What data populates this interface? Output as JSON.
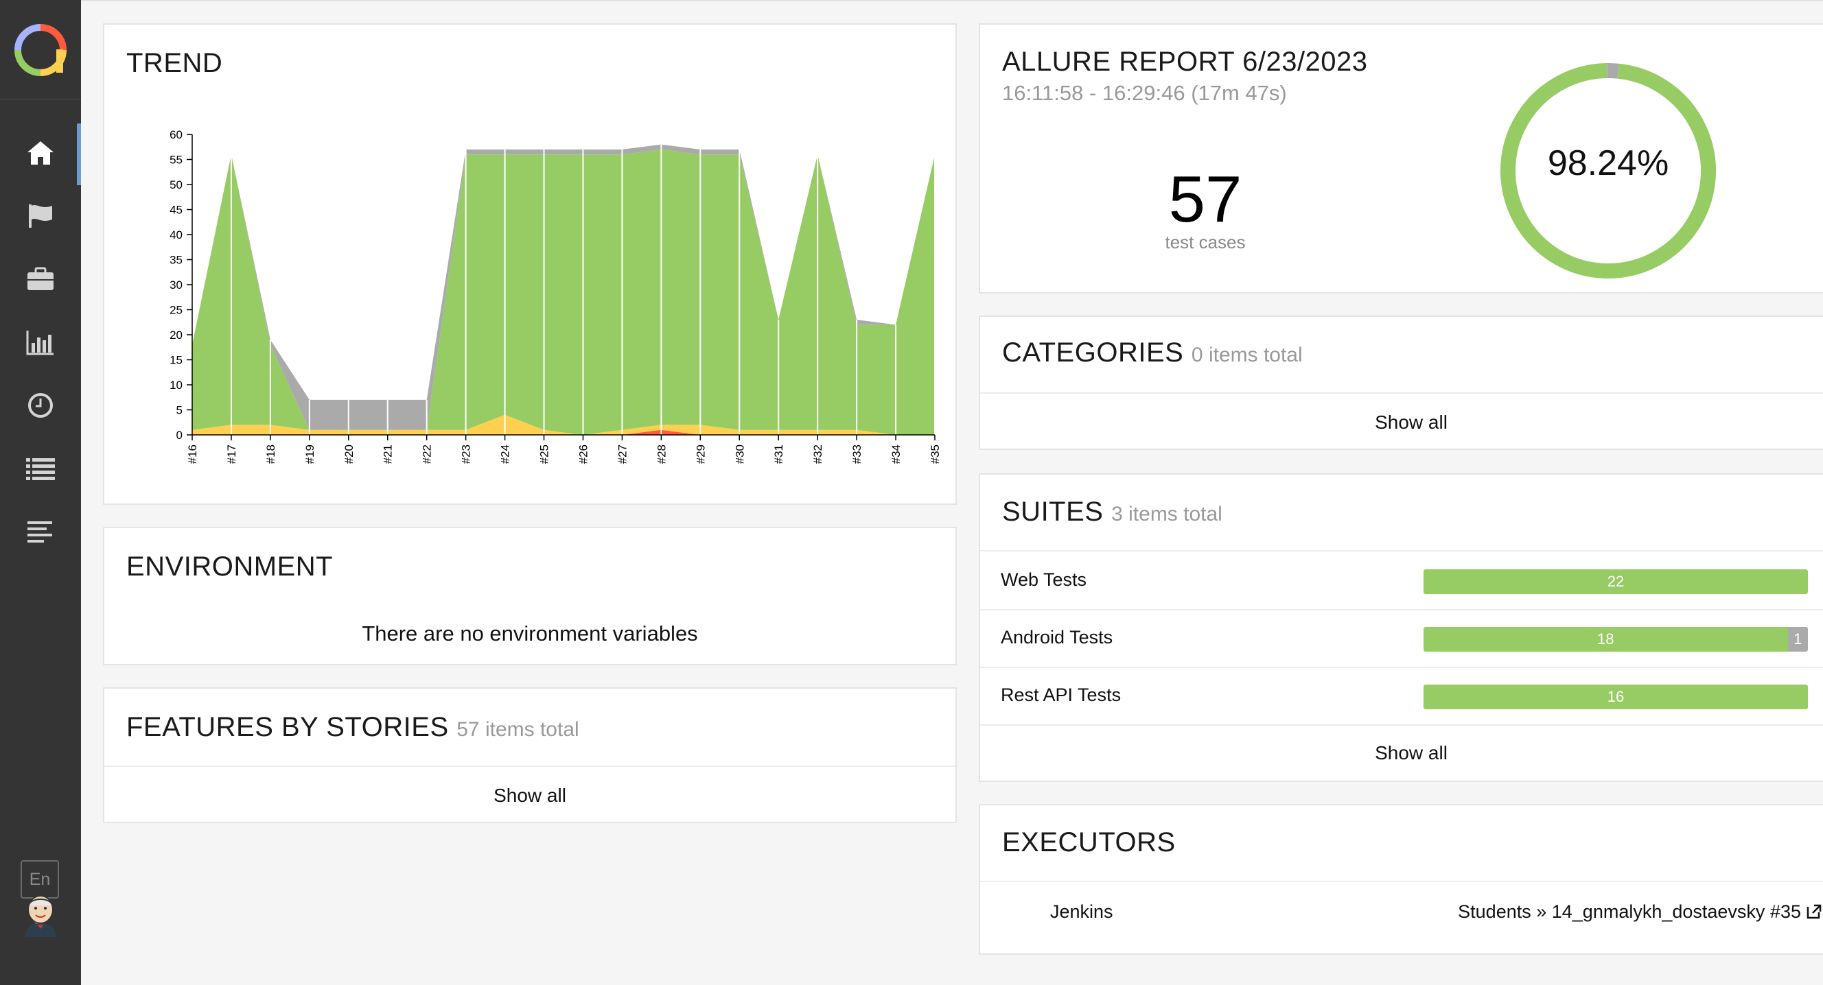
{
  "app": {
    "language": "En"
  },
  "nav": {
    "items": [
      {
        "icon": "home-icon",
        "active": true
      },
      {
        "icon": "flag-icon",
        "active": false
      },
      {
        "icon": "briefcase-icon",
        "active": false
      },
      {
        "icon": "bar-chart-icon",
        "active": false
      },
      {
        "icon": "clock-icon",
        "active": false
      },
      {
        "icon": "list-icon",
        "active": false
      },
      {
        "icon": "timeline-icon",
        "active": false
      }
    ]
  },
  "trend": {
    "title": "TREND",
    "chart_data": {
      "type": "area",
      "x": [
        "#16",
        "#17",
        "#18",
        "#19",
        "#20",
        "#21",
        "#22",
        "#23",
        "#24",
        "#25",
        "#26",
        "#27",
        "#28",
        "#29",
        "#30",
        "#31",
        "#32",
        "#33",
        "#34",
        "#35"
      ],
      "ylim": [
        0,
        60
      ],
      "yticks": [
        0,
        5,
        10,
        15,
        20,
        25,
        30,
        35,
        40,
        45,
        50,
        55,
        60
      ],
      "series": [
        {
          "status": "failed",
          "color": "#fd5a3e",
          "values": [
            0,
            0,
            0,
            0,
            0,
            0,
            0,
            0,
            0,
            0,
            0,
            0,
            1,
            0,
            0,
            0,
            0,
            0,
            0,
            0
          ]
        },
        {
          "status": "broken",
          "color": "#ffd050",
          "values": [
            1,
            2,
            2,
            1,
            1,
            1,
            1,
            1,
            4,
            1,
            0,
            1,
            1,
            2,
            1,
            1,
            1,
            1,
            0,
            0
          ]
        },
        {
          "status": "passed",
          "color": "#97cc64",
          "values": [
            17,
            54,
            16,
            0,
            0,
            0,
            0,
            55,
            52,
            55,
            56,
            55,
            55,
            54,
            55,
            22,
            55,
            21,
            22,
            56
          ]
        },
        {
          "status": "unknown",
          "color": "#aaaaaa",
          "values": [
            0,
            0,
            1,
            6,
            6,
            6,
            6,
            1,
            1,
            1,
            1,
            1,
            1,
            1,
            1,
            0,
            0,
            1,
            0,
            0
          ]
        }
      ],
      "grid": false,
      "legend": "none"
    }
  },
  "environment": {
    "title": "ENVIRONMENT",
    "empty_text": "There are no environment variables"
  },
  "features": {
    "title": "FEATURES BY STORIES",
    "count_text": "57 items total",
    "show_all": "Show all"
  },
  "summary": {
    "title": "ALLURE REPORT 6/23/2023",
    "time_range": "16:11:58 - 16:29:46 (17m 47s)",
    "test_count": "57",
    "test_count_label": "test cases",
    "success_rate": "98.24%",
    "donut": {
      "passed": 56,
      "unknown": 1
    }
  },
  "categories": {
    "title": "CATEGORIES",
    "count_text": "0 items total",
    "show_all": "Show all"
  },
  "suites": {
    "title": "SUITES",
    "count_text": "3 items total",
    "items": [
      {
        "name": "Web Tests",
        "passed": 22,
        "unknown": 0,
        "passed_label": "22",
        "unknown_label": ""
      },
      {
        "name": "Android Tests",
        "passed": 18,
        "unknown": 1,
        "passed_label": "18",
        "unknown_label": "1"
      },
      {
        "name": "Rest API Tests",
        "passed": 16,
        "unknown": 0,
        "passed_label": "16",
        "unknown_label": ""
      }
    ],
    "show_all": "Show all"
  },
  "executors": {
    "title": "EXECUTORS",
    "name": "Jenkins",
    "build": "Students » 14_gnmalykh_dostaevsky #35"
  },
  "colors": {
    "passed": "#97cc64",
    "broken": "#ffd050",
    "failed": "#fd5a3e",
    "unknown": "#aaaaaa",
    "sidebar": "#343434",
    "accent": "#6b9bd2"
  }
}
